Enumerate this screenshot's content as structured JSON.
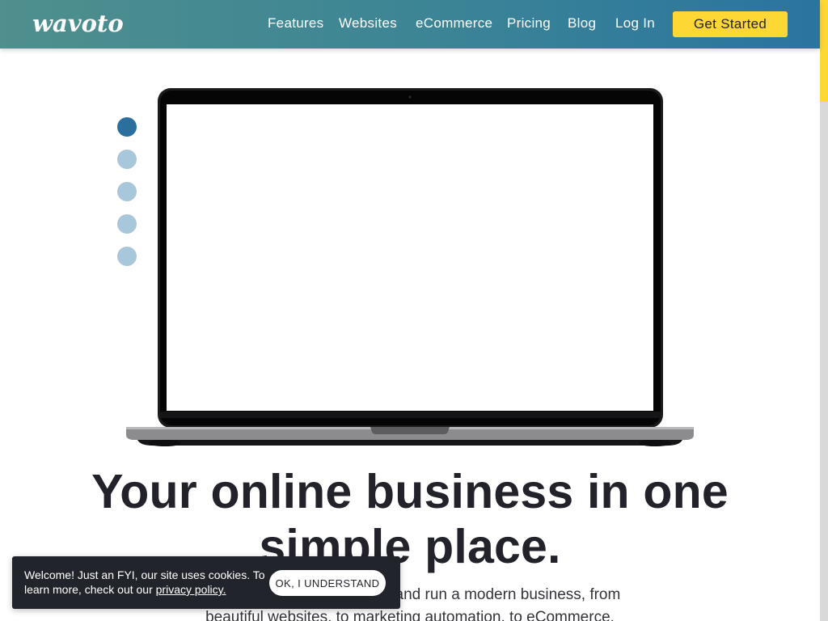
{
  "header": {
    "logo_text": "wavoto",
    "nav": [
      {
        "label": "Features"
      },
      {
        "label": "Websites"
      },
      {
        "label": "eCommerce"
      },
      {
        "label": "Pricing"
      },
      {
        "label": "Blog"
      },
      {
        "label": "Log In"
      }
    ],
    "cta_label": "Get Started"
  },
  "carousel": {
    "slide_count": 5,
    "active_index": 0
  },
  "hero": {
    "title_line1": "Your online business in one",
    "title_line2": "simple place.",
    "subtitle_line1": "Everything you need to start and run a modern business, from",
    "subtitle_line2": "beautiful websites, to marketing automation, to eCommerce."
  },
  "cookie_banner": {
    "text": "Welcome! Just an FYI, our site uses cookies. To learn more, check out our ",
    "link_label": "privacy policy.",
    "button_label": "OK, I UNDERSTAND"
  },
  "colors": {
    "header_gradient_start": "#4f8f8d",
    "header_gradient_end": "#2a74a0",
    "accent_yellow": "#fdd835",
    "dot_active": "#2a6f9e",
    "dot_inactive": "#a9c7da",
    "banner_bg": "#22242b"
  },
  "icons": [
    "logo-wordmark",
    "laptop-mockup"
  ]
}
